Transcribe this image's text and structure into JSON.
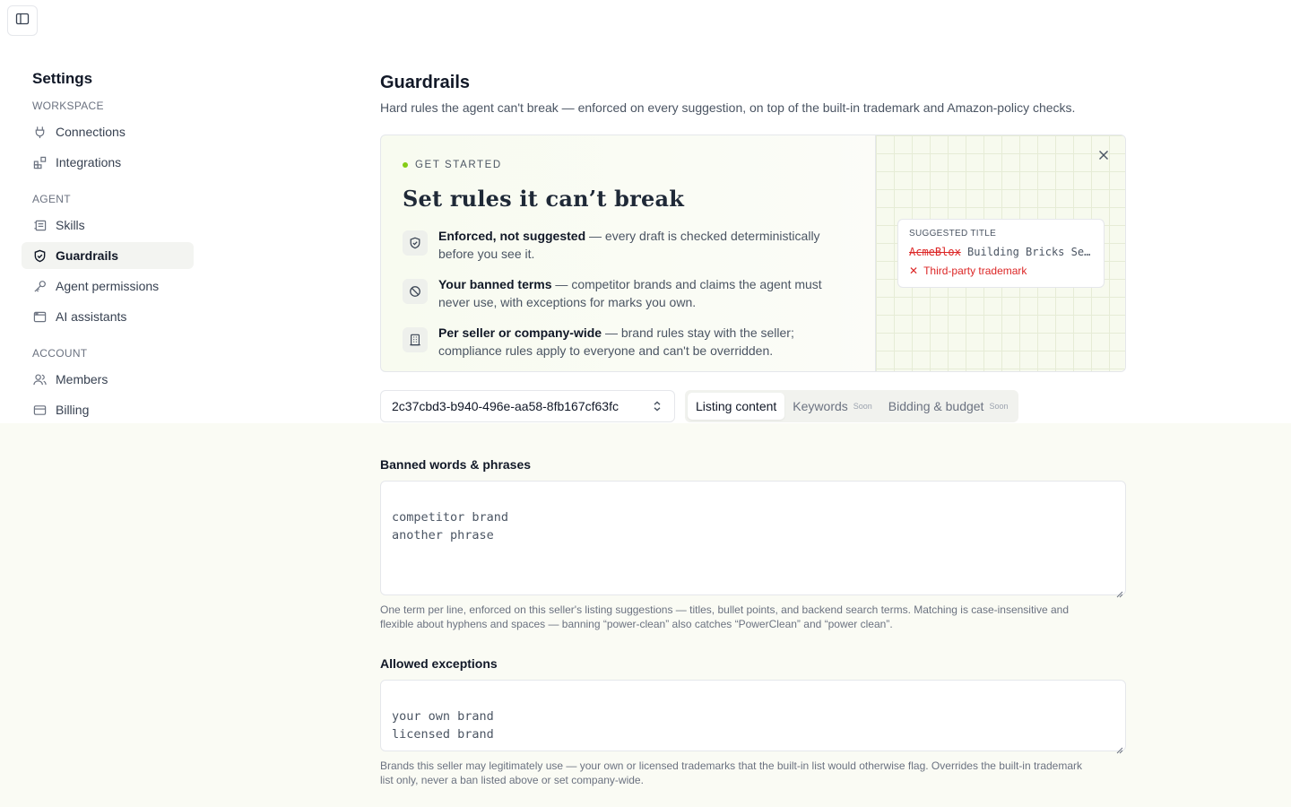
{
  "sidebar": {
    "title": "Settings",
    "sections": {
      "workspace": {
        "label": "WORKSPACE",
        "items": [
          {
            "label": "Connections",
            "icon": "plug-icon"
          },
          {
            "label": "Integrations",
            "icon": "blocks-icon"
          }
        ]
      },
      "agent": {
        "label": "AGENT",
        "items": [
          {
            "label": "Skills",
            "icon": "skills-icon"
          },
          {
            "label": "Guardrails",
            "icon": "shield-icon",
            "active": true
          },
          {
            "label": "Agent permissions",
            "icon": "key-icon"
          },
          {
            "label": "AI assistants",
            "icon": "window-icon"
          }
        ]
      },
      "account": {
        "label": "ACCOUNT",
        "items": [
          {
            "label": "Members",
            "icon": "users-icon"
          },
          {
            "label": "Billing",
            "icon": "card-icon"
          }
        ]
      }
    }
  },
  "page": {
    "title": "Guardrails",
    "subtitle": "Hard rules the agent can't break — enforced on every suggestion, on top of the built-in trademark and Amazon-policy checks."
  },
  "banner": {
    "eyebrow": "GET STARTED",
    "heading": "Set rules it can’t break",
    "features": [
      {
        "bold": "Enforced, not suggested",
        "text": " — every draft is checked deterministically before you see it.",
        "icon": "shield-check-icon"
      },
      {
        "bold": "Your banned terms",
        "text": " — competitor brands and claims the agent must never use, with exceptions for marks you own.",
        "icon": "ban-icon"
      },
      {
        "bold": "Per seller or company-wide",
        "text": " — brand rules stay with the seller; compliance rules apply to everyone and can't be overridden.",
        "icon": "building-icon"
      }
    ],
    "preview": {
      "label": "SUGGESTED TITLE",
      "struck_word": "AcmeBlox",
      "title_rest": " Building Bricks Se…",
      "warning": "Third-party trademark"
    }
  },
  "controls": {
    "seller_id": "2c37cbd3-b940-496e-aa58-8fb167cf63fc",
    "tabs": [
      {
        "label": "Listing content",
        "active": true,
        "badge": ""
      },
      {
        "label": "Keywords",
        "active": false,
        "badge": "Soon"
      },
      {
        "label": "Bidding & budget",
        "active": false,
        "badge": "Soon"
      }
    ]
  },
  "fields": {
    "banned": {
      "label": "Banned words & phrases",
      "value": "competitor brand\nanother phrase",
      "help": "One term per line, enforced on this seller's listing suggestions — titles, bullet points, and backend search terms. Matching is case-insensitive and flexible about hyphens and spaces — banning “power-clean” also catches “PowerClean” and “power clean”."
    },
    "exceptions": {
      "label": "Allowed exceptions",
      "value": "your own brand\nlicensed brand",
      "help": "Brands this seller may legitimately use — your own or licensed trademarks that the built-in list would otherwise flag. Overrides the built-in trademark list only, never a ban listed above or set company-wide."
    }
  },
  "colors": {
    "accent_dot": "#84cc16",
    "warning": "#dc2626",
    "lower_background": "#fafbf4"
  }
}
